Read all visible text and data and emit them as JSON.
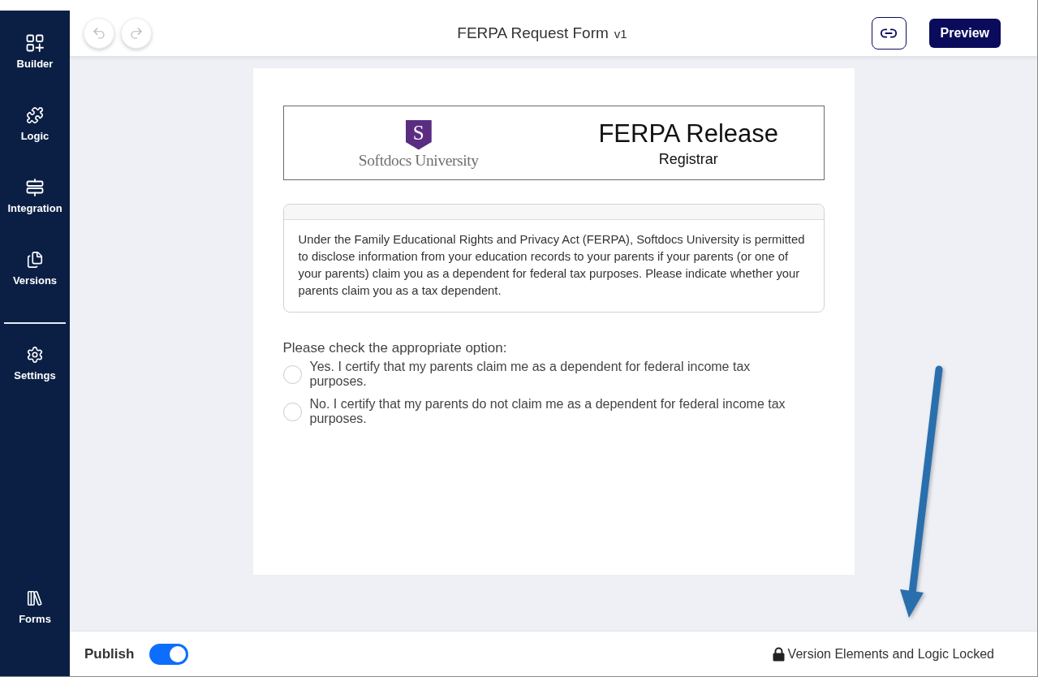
{
  "sidebar": {
    "groups": [
      [
        {
          "label": "Builder"
        },
        {
          "label": "Logic"
        },
        {
          "label": "Integration"
        },
        {
          "label": "Versions"
        }
      ],
      [
        {
          "label": "Settings"
        }
      ]
    ],
    "footer_items": [
      {
        "label": "Forms"
      }
    ]
  },
  "toolbar": {
    "title": "FERPA Request Form",
    "version": "v1",
    "preview_button": "Preview"
  },
  "form": {
    "header": {
      "logo_letter": "S",
      "logo_text": "Softdocs University",
      "title": "FERPA Release",
      "subtitle": "Registrar"
    },
    "notice": "Under the Family Educational Rights and Privacy Act (FERPA), Softdocs University is permitted to disclose information from your education records to your parents if your parents (or one of your parents) claim you as a dependent for federal tax purposes. Please indicate whether your parents claim you as a tax dependent.",
    "question": {
      "label": "Please check the appropriate option:",
      "options": [
        {
          "label": "Yes. I certify that my parents claim me as a dependent for federal income tax purposes.",
          "selected": false
        },
        {
          "label": "No. I certify that my parents do not claim me as a dependent for federal income tax purposes.",
          "selected": false
        }
      ]
    }
  },
  "bottom_bar": {
    "publish_label": "Publish",
    "publish_on": true,
    "lock_status": "Version Elements and Logic Locked"
  }
}
